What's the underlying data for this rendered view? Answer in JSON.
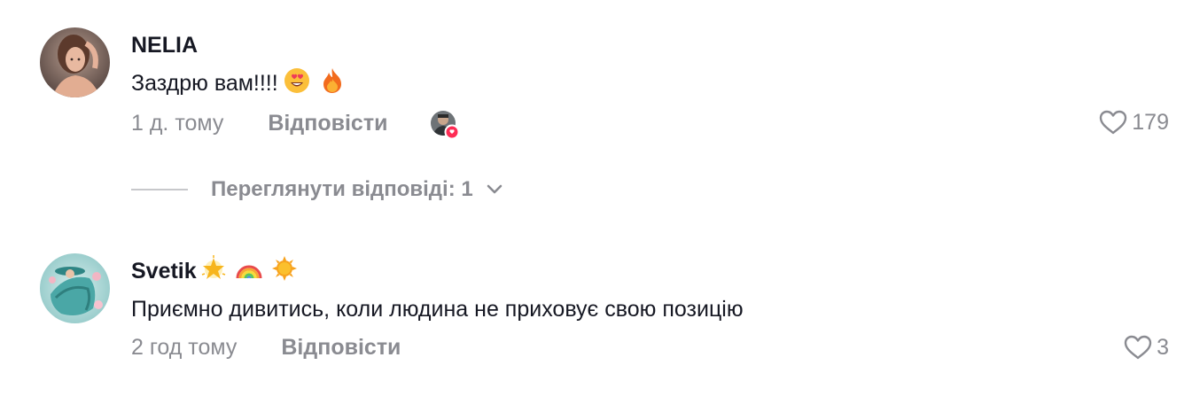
{
  "comments": [
    {
      "username": "NELIA",
      "text": "Заздрю вам!!!!",
      "text_emojis": [
        "smiling-face-with-heart-eyes",
        "fire"
      ],
      "time": "1 д. тому",
      "reply_label": "Відповісти",
      "likes": "179",
      "author_liked": true
    },
    {
      "username": "Svetik",
      "username_emojis": [
        "glowing-star",
        "rainbow",
        "sun"
      ],
      "text": "Приємно дивитись, коли людина не приховує свою позицію",
      "time": "2 год тому",
      "reply_label": "Відповісти",
      "likes": "3"
    }
  ],
  "view_replies": {
    "label": "Переглянути відповіді: 1"
  },
  "colors": {
    "primary_text": "#161823",
    "secondary_text": "#8a8b91",
    "liked_badge": "#fe2c55"
  }
}
